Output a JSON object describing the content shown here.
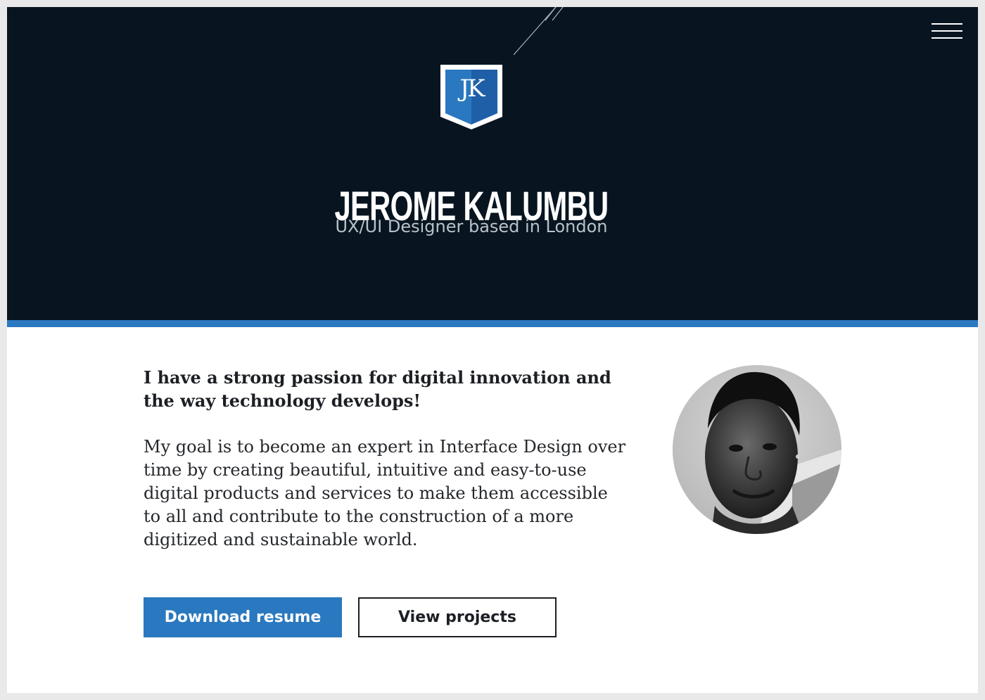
{
  "hero": {
    "logo_text": "JK",
    "name": "JEROME KALUMBU",
    "subtitle": "UX/UI Designer based in London"
  },
  "about": {
    "heading": "I have a strong passion for digital innovation and the way technology develops!",
    "body": "My goal is to become an expert in Interface Design over time by creating beautiful, intuitive and easy-to-use digital products and services to make them accessible to all and contribute to the construction of a more digitized and sustainable world."
  },
  "buttons": {
    "download_label": "Download resume",
    "projects_label": "View projects"
  },
  "icons": {
    "menu": "hamburger-menu-icon",
    "logo": "jk-shield-logo"
  },
  "colors": {
    "hero_background": "#081521",
    "accent": "#2a78bf",
    "text_dark": "#1c1f24"
  }
}
